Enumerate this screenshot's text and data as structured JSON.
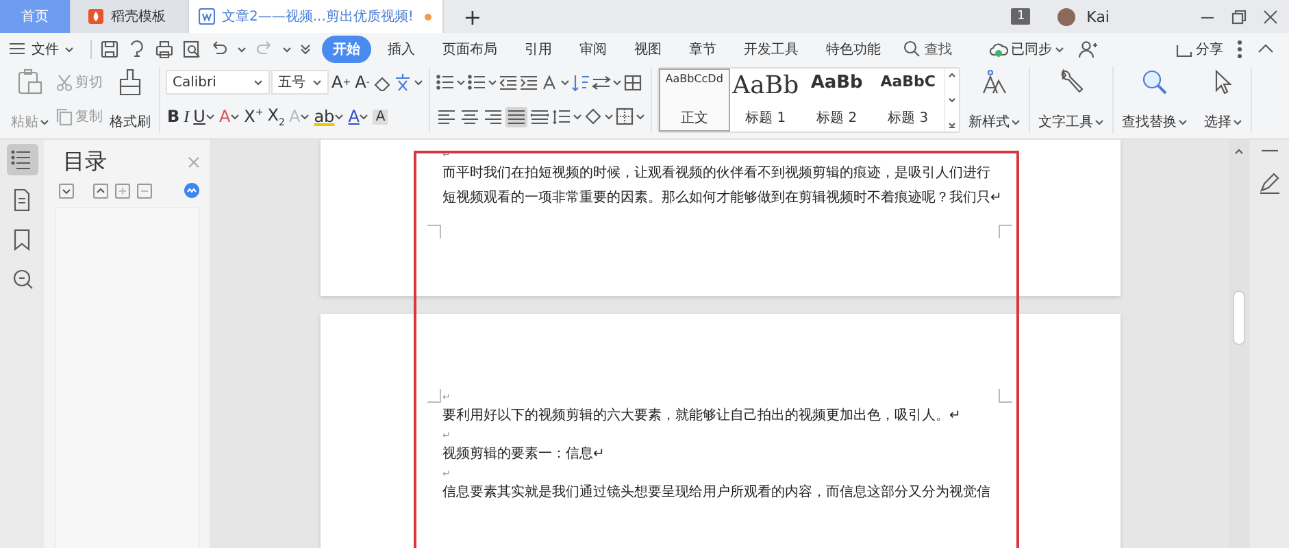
{
  "tabs": [
    {
      "label": "首页",
      "kind": "home",
      "selected": false,
      "unsaved": false
    },
    {
      "label": "稻壳模板",
      "kind": "template",
      "selected": false,
      "unsaved": false
    },
    {
      "label": "文章2——视频...剪出优质视频!",
      "kind": "document",
      "selected": true,
      "unsaved": true
    }
  ],
  "new_tab": "+",
  "title_bar": {
    "badge": "1",
    "user": "Kai"
  },
  "menu": {
    "file": "文件",
    "search": "查找",
    "sync": "已同步",
    "share": "分享",
    "tabs": [
      {
        "label": "开始",
        "selected": true
      },
      {
        "label": "插入",
        "selected": false
      },
      {
        "label": "页面布局",
        "selected": false
      },
      {
        "label": "引用",
        "selected": false
      },
      {
        "label": "审阅",
        "selected": false
      },
      {
        "label": "视图",
        "selected": false
      },
      {
        "label": "章节",
        "selected": false
      },
      {
        "label": "开发工具",
        "selected": false
      },
      {
        "label": "特色功能",
        "selected": false
      }
    ]
  },
  "ribbon": {
    "paste": "粘贴",
    "cut": "剪切",
    "copy": "复制",
    "format_painter": "格式刷",
    "font": "Calibri",
    "size": "五号",
    "grow_font": "A$^{+}$",
    "shrink_font": "A$^{-}$",
    "format_buttons": [
      {
        "label": "B",
        "dropdown": false
      },
      {
        "label": "I",
        "dropdown": false
      },
      {
        "label": "U",
        "dropdown": true
      },
      {
        "label": "A",
        "dropdown": true
      },
      {
        "label": "X$^{+}$",
        "dropdown": false
      },
      {
        "label": "X$_{2}$",
        "dropdown": false
      },
      {
        "label": "A",
        "dropdown": true
      },
      {
        "label": "ab",
        "dropdown": true
      },
      {
        "label": "A",
        "dropdown": true
      },
      {
        "label": "A",
        "dropdown": false
      }
    ],
    "align_buttons": [
      {
        "selected": false
      },
      {
        "selected": false
      },
      {
        "selected": false
      },
      {
        "selected": true
      },
      {
        "selected": false
      }
    ],
    "styles": [
      {
        "preview": "AaBbCcDd",
        "name": "正文",
        "selected": true
      },
      {
        "preview": "AaBb",
        "name": "标题 1",
        "selected": false
      },
      {
        "preview": "AaBb",
        "name": "标题 2",
        "selected": false
      },
      {
        "preview": "AaBbC",
        "name": "标题 3",
        "selected": false
      }
    ],
    "new_style": "新样式",
    "text_tools": "文字工具",
    "find_replace": "查找替换",
    "select": "选择"
  },
  "sidebar_tools": [
    {
      "selected": true
    },
    {
      "selected": false
    },
    {
      "selected": false
    },
    {
      "selected": false
    }
  ],
  "toc": {
    "title": "目录"
  },
  "pages": [
    {
      "lines": [
        {
          "kind": "mark",
          "text": "↵"
        },
        {
          "kind": "text",
          "text": "而平时我们在拍短视频的时候，让观看视频的伙伴看不到视频剪辑的痕迹，是吸引人们进行"
        },
        {
          "kind": "text",
          "text": "短视频观看的一项非常重要的因素。那么如何才能够做到在剪辑视频时不着痕迹呢？我们只↵"
        }
      ]
    },
    {
      "lines": [
        {
          "kind": "mark",
          "text": "↵"
        },
        {
          "kind": "text",
          "text": "要利用好以下的视频剪辑的六大要素，就能够让自己拍出的视频更加出色，吸引人。↵"
        },
        {
          "kind": "mark",
          "text": "↵"
        },
        {
          "kind": "text",
          "text": "视频剪辑的要素一：信息↵"
        },
        {
          "kind": "mark",
          "text": "↵"
        },
        {
          "kind": "text",
          "text": "信息要素其实就是我们通过镜头想要呈现给用户所观看的内容，而信息这部分又分为视觉信"
        }
      ]
    }
  ]
}
